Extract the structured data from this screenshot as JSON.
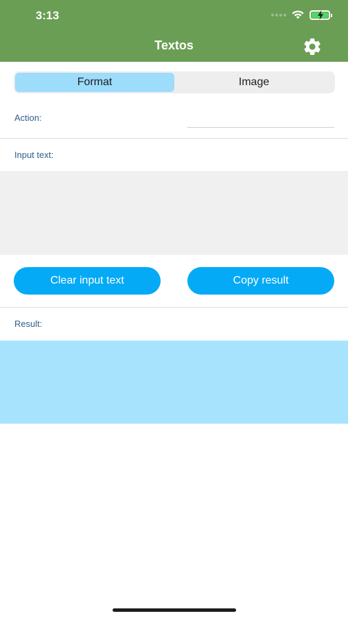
{
  "status_bar": {
    "time": "3:13",
    "signal_icon": "signal-dots-icon",
    "wifi_icon": "wifi-icon",
    "battery_icon": "battery-charging-icon"
  },
  "header": {
    "title": "Textos",
    "settings_icon": "gear-icon",
    "background_color": "#6a9e55"
  },
  "segmented_control": {
    "options": [
      "Format",
      "Image"
    ],
    "selected": "Format",
    "active_color": "#9ddcfb"
  },
  "action": {
    "label": "Action:",
    "value": "",
    "placeholder": ""
  },
  "input": {
    "label": "Input text:",
    "value": ""
  },
  "buttons": {
    "clear_label": "Clear input text",
    "copy_label": "Copy result",
    "color": "#04aaf5"
  },
  "result": {
    "label": "Result:",
    "value": "",
    "background_color": "#a8e3fd"
  }
}
